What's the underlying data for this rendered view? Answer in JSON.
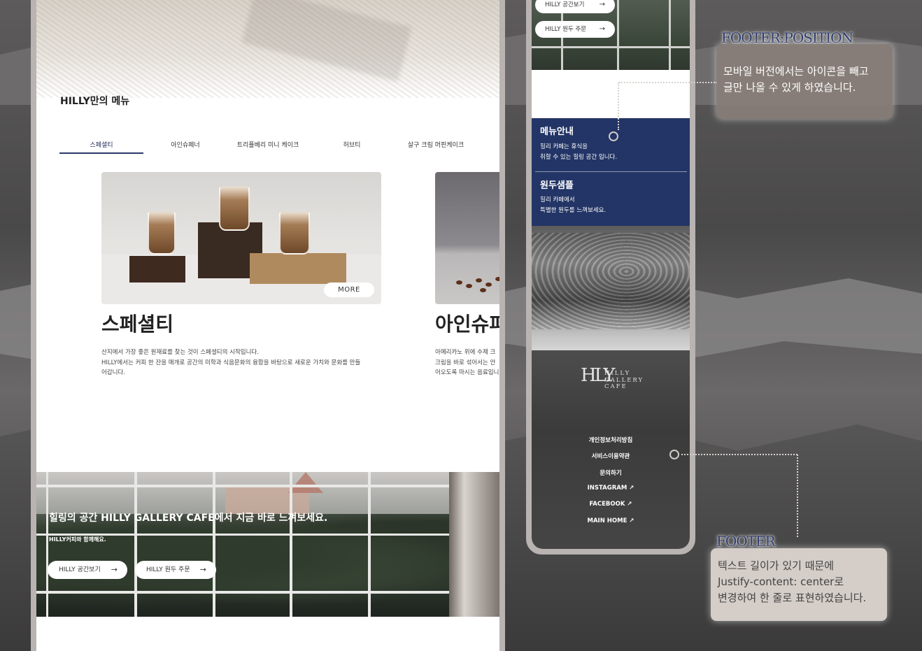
{
  "desktop": {
    "section_title": "HILLY만의 메뉴",
    "tabs": [
      {
        "label": "스페셜티",
        "active": true
      },
      {
        "label": "아인슈페너",
        "active": false
      },
      {
        "label": "트리플베리 미니 케이크",
        "active": false
      },
      {
        "label": "허브티",
        "active": false
      },
      {
        "label": "살구 크림 머핀케이크",
        "active": false
      }
    ],
    "card1": {
      "more_label": "MORE",
      "title": "스페셜티",
      "desc_line1": "산지에서 가장 좋은 원재료를 찾는 것이 스페셜티의 시작입니다.",
      "desc_line2": "HILLY에서는 커피 한 잔을 매개로 공간의 미학과 식음문화의 융합을 바탕으로 새로운 가치와 문화를 만들",
      "desc_line3": "어갑니다."
    },
    "card2": {
      "title": "아인슈퍼",
      "desc_line1": "아메리카노 위에 수제 크",
      "desc_line2": "크림을 바로 섞어서는 안",
      "desc_line3": "어오도록 마시는 음료입니"
    },
    "banner": {
      "title": "힐링의 공간 HILLY GALLERY CAFE에서 지금 바로 느껴보세요.",
      "subtitle": "HILLY커피와 함께해요.",
      "btn_space": "HILLY 공간보기",
      "btn_order": "HILLY 원두 주문",
      "arrow": "→"
    }
  },
  "mobile": {
    "btn_space": "HILLY 공간보기",
    "btn_order": "HILLY 원두 주문",
    "arrow": "→",
    "menu_title": "메뉴안내",
    "menu_desc_line1": "힐리 카페는 휴식을",
    "menu_desc_line2": "취할 수 있는 힐링 공간 입니다.",
    "bean_title": "원두샘플",
    "bean_desc_line1": "힐리 카페에서",
    "bean_desc_line2": "특별한 원두를 느껴보세요.",
    "logo_mark": "HLY",
    "logo_text_1": "HILLY",
    "logo_text_2": "GALLERY",
    "logo_text_3": "CAFE",
    "footer_links": [
      "개인정보처리방침",
      "서비스이용약관",
      "문의하기",
      "INSTAGRAM ↗",
      "FACEBOOK ↗",
      "MAIN HOME ↗"
    ]
  },
  "annotations": {
    "position_label": "FOOTER:POSITION",
    "position_line1": "모바일 버전에서는 아이콘을 빼고",
    "position_line2": "글만 나올 수 있게 하였습니다.",
    "footer_label": "FOOTER",
    "footer_line1": "텍스트 길이가 있기 때문에",
    "footer_line2": "Justify-content: center로",
    "footer_line3": "변경하여 한 줄로 표현하였습니다."
  },
  "colors": {
    "navy": "#233566",
    "accent_label": "#2c3a6a",
    "background": "#4a4949"
  }
}
